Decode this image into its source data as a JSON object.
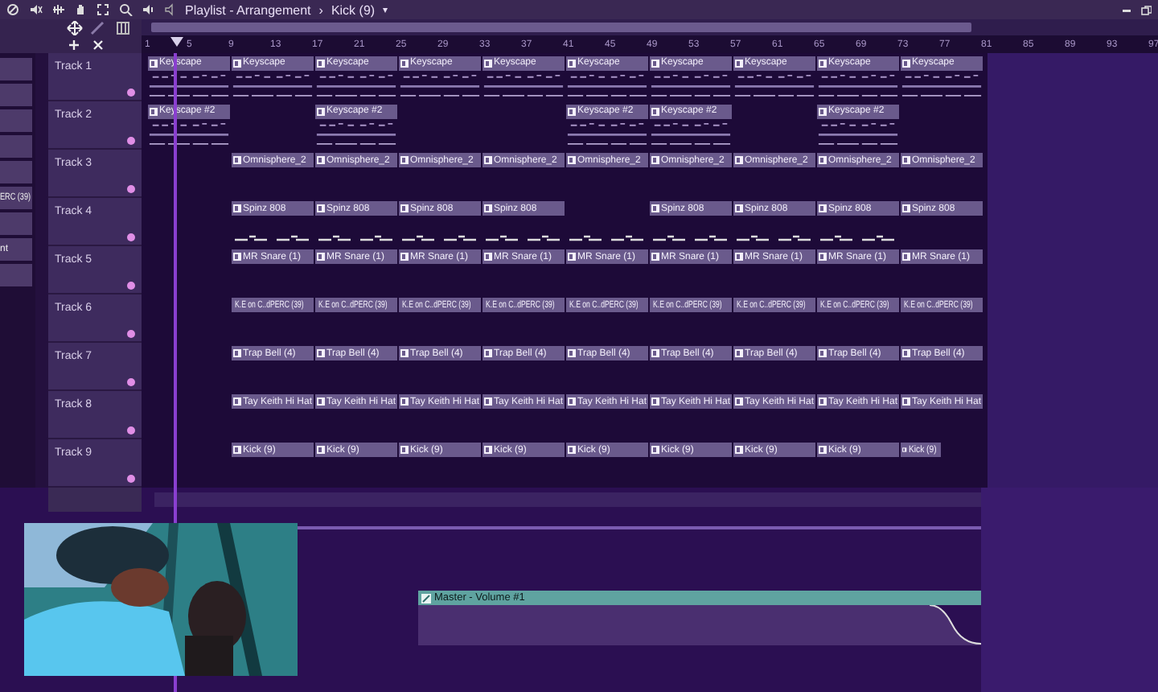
{
  "window": {
    "title": "Playlist - Arrangement",
    "separator": "›",
    "pattern": "Kick (9)",
    "menu_caret": "▾"
  },
  "ruler": {
    "marks": [
      "1",
      "5",
      "9",
      "13",
      "17",
      "21",
      "25",
      "29",
      "33",
      "37",
      "41",
      "45",
      "49",
      "53",
      "57",
      "61",
      "65",
      "69",
      "73",
      "77",
      "81",
      "85",
      "89",
      "93",
      "97"
    ]
  },
  "sidebar": {
    "items": [
      {
        "kind": "button"
      },
      {
        "kind": "button"
      },
      {
        "kind": "button"
      },
      {
        "kind": "button"
      },
      {
        "kind": "button"
      },
      {
        "kind": "button",
        "label": "ERC (39)"
      },
      {
        "kind": "button"
      },
      {
        "kind": "button",
        "label": "nt"
      },
      {
        "kind": "button"
      }
    ]
  },
  "tracks": [
    {
      "name": "Track 1",
      "kind": "pattern",
      "clips": [
        {
          "kind": "clip",
          "label": "Keyscape"
        },
        {
          "kind": "clip",
          "label": "Keyscape"
        },
        {
          "kind": "clip",
          "label": "Keyscape"
        },
        {
          "kind": "clip",
          "label": "Keyscape"
        },
        {
          "kind": "clip",
          "label": "Keyscape"
        },
        {
          "kind": "clip",
          "label": "Keyscape"
        },
        {
          "kind": "clip",
          "label": "Keyscape"
        },
        {
          "kind": "clip",
          "label": "Keyscape"
        },
        {
          "kind": "clip",
          "label": "Keyscape"
        },
        {
          "kind": "clip",
          "label": "Keyscape"
        }
      ]
    },
    {
      "name": "Track 2",
      "kind": "pattern",
      "clips": [
        {
          "kind": "clip",
          "label": "Keyscape #2"
        },
        {
          "kind": "gap"
        },
        {
          "kind": "clip",
          "label": "Keyscape #2"
        },
        {
          "kind": "gap"
        },
        {
          "kind": "gap"
        },
        {
          "kind": "clip",
          "label": "Keyscape #2"
        },
        {
          "kind": "clip",
          "label": "Keyscape #2"
        },
        {
          "kind": "gap"
        },
        {
          "kind": "clip",
          "label": "Keyscape #2"
        },
        {
          "kind": "gap"
        }
      ]
    },
    {
      "name": "Track 3",
      "kind": "plain",
      "clips": [
        {
          "kind": "gap"
        },
        {
          "kind": "clip",
          "label": "Omnisphere_2"
        },
        {
          "kind": "clip",
          "label": "Omnisphere_2"
        },
        {
          "kind": "clip",
          "label": "Omnisphere_2"
        },
        {
          "kind": "clip",
          "label": "Omnisphere_2"
        },
        {
          "kind": "clip",
          "label": "Omnisphere_2"
        },
        {
          "kind": "clip",
          "label": "Omnisphere_2"
        },
        {
          "kind": "clip",
          "label": "Omnisphere_2"
        },
        {
          "kind": "clip",
          "label": "Omnisphere_2"
        },
        {
          "kind": "clip",
          "label": "Omnisphere_2"
        }
      ]
    },
    {
      "name": "Track 4",
      "kind": "dashes",
      "clips": [
        {
          "kind": "gap"
        },
        {
          "kind": "clip",
          "label": "Spinz 808"
        },
        {
          "kind": "clip",
          "label": "Spinz 808"
        },
        {
          "kind": "clip",
          "label": "Spinz 808"
        },
        {
          "kind": "clip",
          "label": "Spinz 808"
        },
        {
          "kind": "gap"
        },
        {
          "kind": "clip",
          "label": "Spinz 808"
        },
        {
          "kind": "clip",
          "label": "Spinz 808"
        },
        {
          "kind": "clip",
          "label": "Spinz 808"
        },
        {
          "kind": "clip",
          "label": "Spinz 808"
        }
      ]
    },
    {
      "name": "Track 5",
      "kind": "plain",
      "clips": [
        {
          "kind": "gap"
        },
        {
          "kind": "clip",
          "label": "MR Snare (1)"
        },
        {
          "kind": "clip",
          "label": "MR Snare (1)"
        },
        {
          "kind": "clip",
          "label": "MR Snare (1)"
        },
        {
          "kind": "clip",
          "label": "MR Snare (1)"
        },
        {
          "kind": "clip",
          "label": "MR Snare (1)"
        },
        {
          "kind": "clip",
          "label": "MR Snare (1)"
        },
        {
          "kind": "clip",
          "label": "MR Snare (1)"
        },
        {
          "kind": "clip",
          "label": "MR Snare (1)"
        },
        {
          "kind": "clip",
          "label": "MR Snare (1)"
        }
      ]
    },
    {
      "name": "Track 6",
      "kind": "plain",
      "clips": [
        {
          "kind": "gap"
        },
        {
          "kind": "clip",
          "label": "K.E on C..dPERC (39)"
        },
        {
          "kind": "clip",
          "label": "K.E on C..dPERC (39)"
        },
        {
          "kind": "clip",
          "label": "K.E on C..dPERC (39)"
        },
        {
          "kind": "clip",
          "label": "K.E on C..dPERC (39)"
        },
        {
          "kind": "clip",
          "label": "K.E on C..dPERC (39)"
        },
        {
          "kind": "clip",
          "label": "K.E on C..dPERC (39)"
        },
        {
          "kind": "clip",
          "label": "K.E on C..dPERC (39)"
        },
        {
          "kind": "clip",
          "label": "K.E on C..dPERC (39)"
        },
        {
          "kind": "clip",
          "label": "K.E on C..dPERC (39)"
        }
      ]
    },
    {
      "name": "Track 7",
      "kind": "plain",
      "clips": [
        {
          "kind": "gap"
        },
        {
          "kind": "clip",
          "label": "Trap Bell (4)"
        },
        {
          "kind": "clip",
          "label": "Trap Bell (4)"
        },
        {
          "kind": "clip",
          "label": "Trap Bell (4)"
        },
        {
          "kind": "clip",
          "label": "Trap Bell (4)"
        },
        {
          "kind": "clip",
          "label": "Trap Bell (4)"
        },
        {
          "kind": "clip",
          "label": "Trap Bell (4)"
        },
        {
          "kind": "clip",
          "label": "Trap Bell (4)"
        },
        {
          "kind": "clip",
          "label": "Trap Bell (4)"
        },
        {
          "kind": "clip",
          "label": "Trap Bell (4)"
        }
      ]
    },
    {
      "name": "Track 8",
      "kind": "plain",
      "clips": [
        {
          "kind": "gap"
        },
        {
          "kind": "clip",
          "label": "Tay Keith Hi Hat"
        },
        {
          "kind": "clip",
          "label": "Tay Keith Hi Hat"
        },
        {
          "kind": "clip",
          "label": "Tay Keith Hi Hat"
        },
        {
          "kind": "clip",
          "label": "Tay Keith Hi Hat"
        },
        {
          "kind": "clip",
          "label": "Tay Keith Hi Hat"
        },
        {
          "kind": "clip",
          "label": "Tay Keith Hi Hat"
        },
        {
          "kind": "clip",
          "label": "Tay Keith Hi Hat"
        },
        {
          "kind": "clip",
          "label": "Tay Keith Hi Hat"
        },
        {
          "kind": "clip",
          "label": "Tay Keith Hi Hat"
        }
      ]
    },
    {
      "name": "Track 9",
      "kind": "plain",
      "clips": [
        {
          "kind": "gap"
        },
        {
          "kind": "clip",
          "label": "Kick (9)"
        },
        {
          "kind": "clip",
          "label": "Kick (9)"
        },
        {
          "kind": "clip",
          "label": "Kick (9)"
        },
        {
          "kind": "clip",
          "label": "Kick (9)"
        },
        {
          "kind": "clip",
          "label": "Kick (9)"
        },
        {
          "kind": "clip",
          "label": "Kick (9)"
        },
        {
          "kind": "clip",
          "label": "Kick (9)"
        },
        {
          "kind": "clip",
          "label": "Kick (9)"
        },
        {
          "kind": "short",
          "label": "Kick (9)"
        }
      ]
    }
  ],
  "automation": {
    "label": "Master - Volume #1"
  }
}
